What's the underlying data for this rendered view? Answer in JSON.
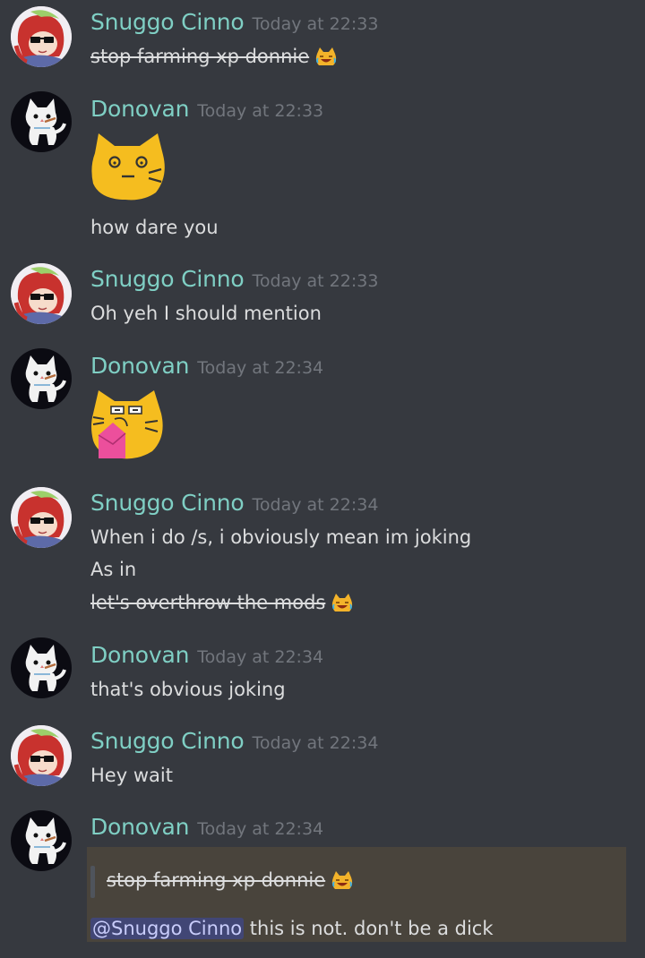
{
  "messages": [
    {
      "author": "Snuggo Cinno",
      "time": "Today at 22:33",
      "lines": [
        "stop farming xp donnie"
      ]
    },
    {
      "author": "Donovan",
      "time": "Today at 22:33",
      "lines": [
        "how dare you"
      ]
    },
    {
      "author": "Snuggo Cinno",
      "time": "Today at 22:33",
      "lines": [
        "Oh yeh I should mention"
      ]
    },
    {
      "author": "Donovan",
      "time": "Today at 22:34",
      "lines": []
    },
    {
      "author": "Snuggo Cinno",
      "time": "Today at 22:34",
      "lines": [
        "When i do /s, i obviously mean im joking",
        "As in",
        "let's overthrow the mods"
      ]
    },
    {
      "author": "Donovan",
      "time": "Today at 22:34",
      "lines": [
        "that's obvious joking"
      ]
    },
    {
      "author": "Snuggo Cinno",
      "time": "Today at 22:34",
      "lines": [
        "Hey wait"
      ]
    },
    {
      "author": "Donovan",
      "time": "Today at 22:34",
      "quote": "stop farming xp donnie",
      "mention": "@Snuggo Cinno",
      "text": "this is not. don't be a dick"
    }
  ],
  "icons": {
    "sneaky_emoji": "laughing-cat-emoji",
    "cat_shocked": "shocked-cat-emoji",
    "cat_angry": "angry-cat-emoji",
    "avatar_snuggo": "anime-girl-sunglasses-avatar",
    "avatar_donovan": "white-cat-avatar"
  },
  "colors": {
    "background": "#36393f",
    "username": "#7fcfc4",
    "timestamp": "#72767d",
    "text": "#dcddde",
    "mention_bg": "#414675",
    "mention_text": "#c9cdfb",
    "highlight_bg": "#49443c"
  }
}
